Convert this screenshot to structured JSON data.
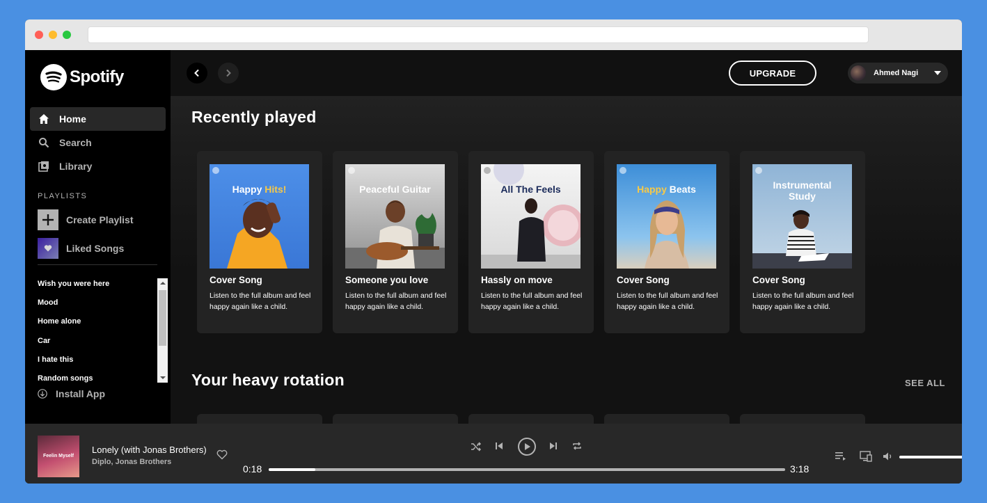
{
  "app": {
    "logo_text": "Spotify"
  },
  "sidebar": {
    "nav": [
      {
        "label": "Home",
        "icon": "home-icon",
        "active": true
      },
      {
        "label": "Search",
        "icon": "search-icon",
        "active": false
      },
      {
        "label": "Library",
        "icon": "library-icon",
        "active": false
      }
    ],
    "playlists_label": "PLAYLISTS",
    "create_playlist": "Create Playlist",
    "liked_songs": "Liked Songs",
    "playlists": [
      "Wish you were here",
      "Mood",
      "Home alone",
      "Car",
      "I hate this",
      "Random songs"
    ],
    "install_app": "Install App"
  },
  "topbar": {
    "upgrade_label": "UPGRADE",
    "user_name": "Ahmed Nagi"
  },
  "main": {
    "recently_played_title": "Recently played",
    "heavy_rotation_title": "Your heavy rotation",
    "see_all": "SEE ALL",
    "cards": [
      {
        "cover_title": "Happy Hits!",
        "cover_title_parts": [
          "Happy ",
          "Hits!"
        ],
        "title": "Cover Song",
        "description": "Listen to the full album and feel happy again like a child."
      },
      {
        "cover_title": "Peaceful Guitar",
        "cover_title_parts": [
          "Peaceful Guitar",
          ""
        ],
        "title": "Someone you love",
        "description": "Listen to the full album and feel happy again like a child."
      },
      {
        "cover_title": "All The Feels",
        "cover_title_parts": [
          "All The Feels",
          ""
        ],
        "title": "Hassly on move",
        "description": "Listen to the full album and feel happy again like a child."
      },
      {
        "cover_title": "Happy Beats",
        "cover_title_parts": [
          "Happy ",
          "Beats"
        ],
        "title": "Cover Song",
        "description": "Listen to the full album and feel happy again like a child."
      },
      {
        "cover_title": "Instrumental Study",
        "cover_title_parts": [
          "Instrumental Study",
          ""
        ],
        "title": "Cover Song",
        "description": "Listen to the full album and feel happy again like a child."
      }
    ]
  },
  "player": {
    "track_title": "Lonely (with Jonas Brothers)",
    "artist": "Diplo, Jonas Brothers",
    "art_text": "Feelin Myself",
    "elapsed": "0:18",
    "duration": "3:18",
    "progress": 0.09,
    "volume": 1.0
  },
  "colors": {
    "accent_yellow": "#f7c948",
    "background": "#121212",
    "sidebar": "#000000",
    "player": "#282828",
    "frame": "#4a90e2"
  }
}
